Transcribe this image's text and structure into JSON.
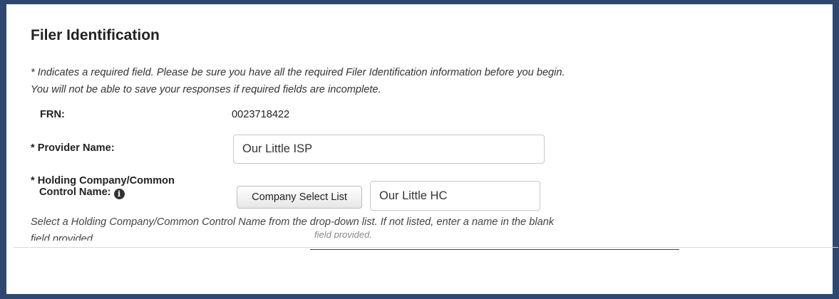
{
  "form": {
    "title": "Filer Identification",
    "instructions": [
      "* Indicates a required field. Please be sure you have all the required Filer Identification information before you begin.",
      "You will not be able to save your responses if required fields are incomplete."
    ],
    "frn": {
      "label": "FRN:",
      "value": "0023718422"
    },
    "provider_name": {
      "label": "* Provider Name:",
      "value": "Our Little ISP"
    },
    "holding_company": {
      "label_line1": "* Holding Company/Common",
      "label_line2": "Control Name:",
      "info_icon": "info-icon",
      "button_label": "Company Select List",
      "value": "Our Little HC"
    },
    "help_text": [
      "Select a Holding Company/Common Control Name from the drop-down list. If not listed, enter a name in the blank",
      "field provided."
    ],
    "ghost_text": "field provided."
  },
  "colors": {
    "frame": "#2f4872",
    "text": "#222222"
  }
}
